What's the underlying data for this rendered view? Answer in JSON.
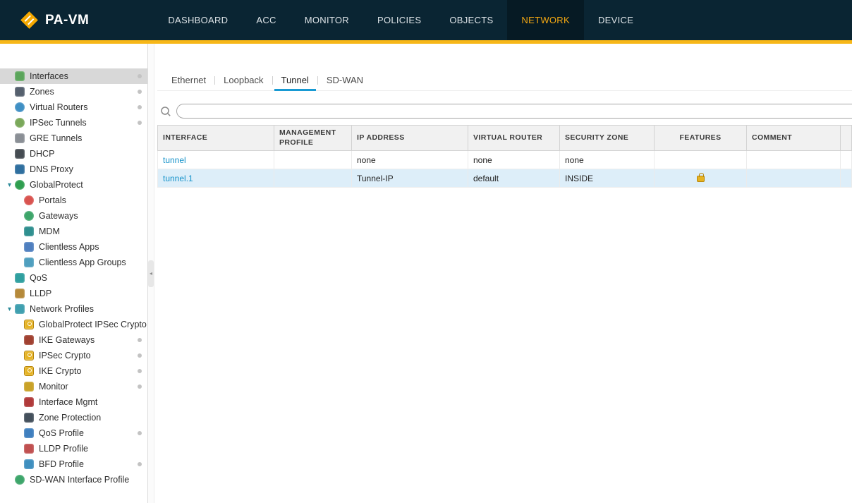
{
  "header": {
    "logo_text": "PA-VM",
    "nav": [
      {
        "label": "DASHBOARD",
        "active": false
      },
      {
        "label": "ACC",
        "active": false
      },
      {
        "label": "MONITOR",
        "active": false
      },
      {
        "label": "POLICIES",
        "active": false
      },
      {
        "label": "OBJECTS",
        "active": false
      },
      {
        "label": "NETWORK",
        "active": true
      },
      {
        "label": "DEVICE",
        "active": false
      }
    ],
    "colors": {
      "bar": "#0a2533",
      "active_text": "#f3a712",
      "accent": "#f7b718"
    }
  },
  "sidebar": {
    "items": [
      {
        "label": "Interfaces",
        "icon": "interfaces-icon",
        "selected": true,
        "dot": true
      },
      {
        "label": "Zones",
        "icon": "zones-icon",
        "dot": true
      },
      {
        "label": "Virtual Routers",
        "icon": "virtual-routers-icon",
        "dot": true
      },
      {
        "label": "IPSec Tunnels",
        "icon": "ipsec-tunnels-icon",
        "dot": true
      },
      {
        "label": "GRE Tunnels",
        "icon": "gre-tunnels-icon",
        "dot": false
      },
      {
        "label": "DHCP",
        "icon": "dhcp-icon",
        "dot": false
      },
      {
        "label": "DNS Proxy",
        "icon": "dns-proxy-icon",
        "dot": false
      },
      {
        "label": "GlobalProtect",
        "icon": "globalprotect-icon",
        "expanded": true,
        "dot": false
      },
      {
        "label": "Portals",
        "icon": "portals-icon",
        "child": true,
        "dot": false
      },
      {
        "label": "Gateways",
        "icon": "gateways-icon",
        "child": true,
        "dot": false
      },
      {
        "label": "MDM",
        "icon": "mdm-icon",
        "child": true,
        "dot": false
      },
      {
        "label": "Clientless Apps",
        "icon": "clientless-apps-icon",
        "child": true,
        "dot": false
      },
      {
        "label": "Clientless App Groups",
        "icon": "clientless-app-groups-icon",
        "child": true,
        "dot": false
      },
      {
        "label": "QoS",
        "icon": "qos-icon",
        "dot": false
      },
      {
        "label": "LLDP",
        "icon": "lldp-icon",
        "dot": false
      },
      {
        "label": "Network Profiles",
        "icon": "network-profiles-icon",
        "expanded": true,
        "dot": false
      },
      {
        "label": "GlobalProtect IPSec Crypto",
        "icon": "gp-ipsec-crypto-icon",
        "child": true,
        "dot": false
      },
      {
        "label": "IKE Gateways",
        "icon": "ike-gateways-icon",
        "child": true,
        "dot": true
      },
      {
        "label": "IPSec Crypto",
        "icon": "ipsec-crypto-icon",
        "child": true,
        "dot": true
      },
      {
        "label": "IKE Crypto",
        "icon": "ike-crypto-icon",
        "child": true,
        "dot": true
      },
      {
        "label": "Monitor",
        "icon": "monitor-icon",
        "child": true,
        "dot": true
      },
      {
        "label": "Interface Mgmt",
        "icon": "interface-mgmt-icon",
        "child": true,
        "dot": false
      },
      {
        "label": "Zone Protection",
        "icon": "zone-protection-icon",
        "child": true,
        "dot": false
      },
      {
        "label": "QoS Profile",
        "icon": "qos-profile-icon",
        "child": true,
        "dot": true
      },
      {
        "label": "LLDP Profile",
        "icon": "lldp-profile-icon",
        "child": true,
        "dot": false
      },
      {
        "label": "BFD Profile",
        "icon": "bfd-profile-icon",
        "child": true,
        "dot": true
      },
      {
        "label": "SD-WAN Interface Profile",
        "icon": "sdwan-interface-profile-icon",
        "dot": false
      }
    ]
  },
  "main": {
    "tabs": [
      {
        "label": "Ethernet",
        "active": false
      },
      {
        "label": "Loopback",
        "active": false
      },
      {
        "label": "Tunnel",
        "active": true
      },
      {
        "label": "SD-WAN",
        "active": false
      }
    ],
    "search": {
      "value": "",
      "placeholder": ""
    },
    "table": {
      "columns": [
        "INTERFACE",
        "MANAGEMENT PROFILE",
        "IP ADDRESS",
        "VIRTUAL ROUTER",
        "SECURITY ZONE",
        "FEATURES",
        "COMMENT"
      ],
      "link_color": "#1592ca",
      "rows": [
        {
          "interface": "tunnel",
          "management_profile": "",
          "ip_address": "none",
          "virtual_router": "none",
          "security_zone": "none",
          "features": "",
          "comment": "",
          "selected": false
        },
        {
          "interface": "tunnel.1",
          "management_profile": "",
          "ip_address": "Tunnel-IP",
          "virtual_router": "default",
          "security_zone": "INSIDE",
          "features": "lock-icon",
          "comment": "",
          "selected": true
        }
      ]
    }
  }
}
